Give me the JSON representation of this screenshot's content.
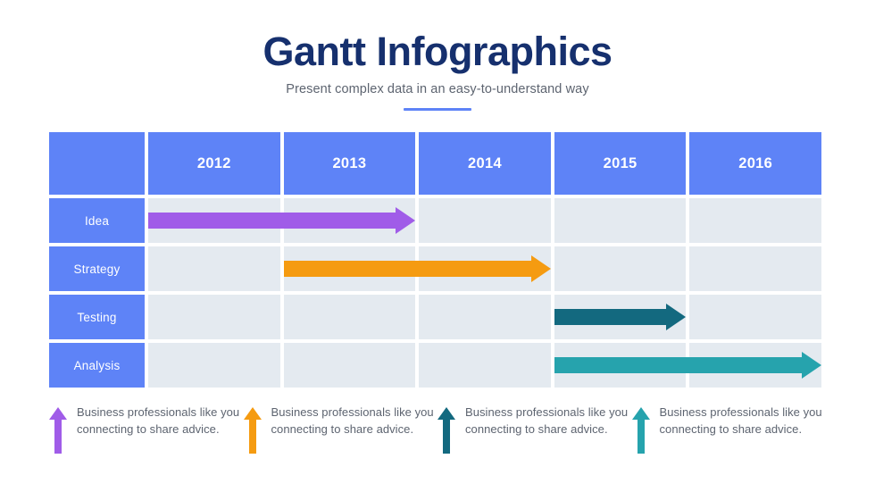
{
  "header": {
    "title": "Gantt Infographics",
    "subtitle": "Present complex data in an easy-to-understand way",
    "accent_color": "#5e83f7",
    "title_color": "#16306e"
  },
  "chart_data": {
    "type": "gantt",
    "title": "Gantt Infographics",
    "corner_label": "",
    "categories": [
      "2012",
      "2013",
      "2014",
      "2015",
      "2016"
    ],
    "tasks": [
      {
        "label": "Idea",
        "start_index": 0,
        "end_index": 1,
        "start_year": "2012",
        "end_year": "2013",
        "color": "#a05ce8"
      },
      {
        "label": "Strategy",
        "start_index": 1,
        "end_index": 2,
        "start_year": "2013",
        "end_year": "2014",
        "color": "#f59b11"
      },
      {
        "label": "Testing",
        "start_index": 3,
        "end_index": 3,
        "start_year": "2015",
        "end_year": "2015",
        "color": "#13697f"
      },
      {
        "label": "Analysis",
        "start_index": 3,
        "end_index": 4,
        "start_year": "2015",
        "end_year": "2016",
        "color": "#26a3ad"
      }
    ],
    "header_cell_color": "#5e83f7",
    "data_cell_color": "#e4eaf0",
    "label_text_color": "#ffffff"
  },
  "legend": {
    "items": [
      {
        "color": "#a05ce8",
        "text": "Business professionals like you connecting to share advice."
      },
      {
        "color": "#f59b11",
        "text": "Business professionals like you connecting to share advice."
      },
      {
        "color": "#13697f",
        "text": "Business professionals like you connecting to share advice."
      },
      {
        "color": "#26a3ad",
        "text": "Business professionals like you connecting to share advice."
      }
    ]
  }
}
